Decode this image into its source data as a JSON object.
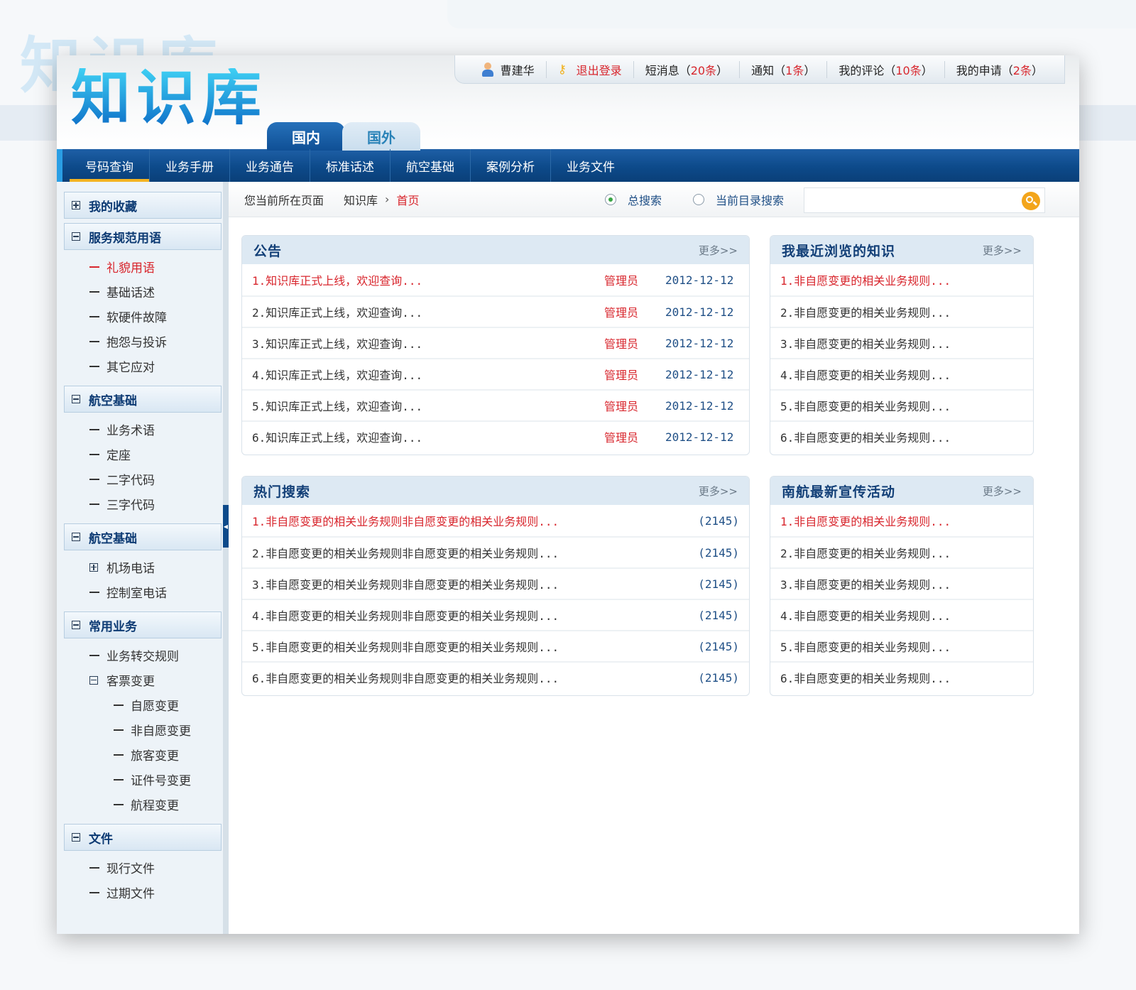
{
  "user_bar": {
    "username": "曹建华",
    "logout": "退出登录",
    "messages": {
      "label": "短消息",
      "count": "20条"
    },
    "notices": {
      "label": "通知",
      "count": "1条"
    },
    "comments": {
      "label": "我的评论",
      "count": "10条"
    },
    "requests": {
      "label": "我的申请",
      "count": "2条"
    }
  },
  "logo": "知识库",
  "region_tabs": [
    {
      "label": "国内",
      "active": true
    },
    {
      "label": "国外",
      "active": false
    }
  ],
  "nav": [
    {
      "label": "号码查询",
      "active": true
    },
    {
      "label": "业务手册"
    },
    {
      "label": "业务通告"
    },
    {
      "label": "标准话述"
    },
    {
      "label": "航空基础"
    },
    {
      "label": "案例分析"
    },
    {
      "label": "业务文件"
    }
  ],
  "breadcrumb": {
    "prefix": "您当前所在页面",
    "root": "知识库",
    "separator": "›",
    "current": "首页"
  },
  "search": {
    "options": [
      {
        "label": "总搜索",
        "checked": true
      },
      {
        "label": "当前目录搜索",
        "checked": false
      }
    ],
    "value": "",
    "placeholder": ""
  },
  "sidebar": {
    "groups": [
      {
        "title": "我的收藏",
        "expanded": false,
        "items": []
      },
      {
        "title": "服务规范用语",
        "expanded": true,
        "items": [
          {
            "label": "礼貌用语",
            "active": true
          },
          {
            "label": "基础话述"
          },
          {
            "label": "软硬件故障"
          },
          {
            "label": "抱怨与投诉"
          },
          {
            "label": "其它应对"
          }
        ]
      },
      {
        "title": "航空基础",
        "expanded": true,
        "items": [
          {
            "label": "业务术语"
          },
          {
            "label": "定座"
          },
          {
            "label": "二字代码"
          },
          {
            "label": "三字代码"
          }
        ]
      },
      {
        "title": "航空基础",
        "expanded": true,
        "items": [
          {
            "label": "机场电话",
            "expandable": true
          },
          {
            "label": "控制室电话"
          }
        ]
      },
      {
        "title": "常用业务",
        "expanded": true,
        "items": [
          {
            "label": "业务转交规则"
          },
          {
            "label": "客票变更",
            "collapsible": true
          },
          {
            "label": "自愿变更",
            "level": 2
          },
          {
            "label": "非自愿变更",
            "level": 2
          },
          {
            "label": "旅客变更",
            "level": 2
          },
          {
            "label": "证件号变更",
            "level": 2
          },
          {
            "label": "航程变更",
            "level": 2
          }
        ]
      },
      {
        "title": "文件",
        "expanded": true,
        "items": [
          {
            "label": "现行文件"
          },
          {
            "label": "过期文件"
          }
        ]
      }
    ]
  },
  "panels": {
    "announcements": {
      "title": "公告",
      "more": "更多>>",
      "rows": [
        {
          "text": "1.知识库正式上线，欢迎查询...",
          "author": "管理员",
          "date": "2012-12-12"
        },
        {
          "text": "2.知识库正式上线，欢迎查询...",
          "author": "管理员",
          "date": "2012-12-12"
        },
        {
          "text": "3.知识库正式上线，欢迎查询...",
          "author": "管理员",
          "date": "2012-12-12"
        },
        {
          "text": "4.知识库正式上线，欢迎查询...",
          "author": "管理员",
          "date": "2012-12-12"
        },
        {
          "text": "5.知识库正式上线，欢迎查询...",
          "author": "管理员",
          "date": "2012-12-12"
        },
        {
          "text": "6.知识库正式上线，欢迎查询...",
          "author": "管理员",
          "date": "2012-12-12"
        }
      ]
    },
    "recent": {
      "title": "我最近浏览的知识",
      "more": "更多>>",
      "rows": [
        {
          "text": "1.非自愿变更的相关业务规则..."
        },
        {
          "text": "2.非自愿变更的相关业务规则..."
        },
        {
          "text": "3.非自愿变更的相关业务规则..."
        },
        {
          "text": "4.非自愿变更的相关业务规则..."
        },
        {
          "text": "5.非自愿变更的相关业务规则..."
        },
        {
          "text": "6.非自愿变更的相关业务规则..."
        }
      ]
    },
    "hot_search": {
      "title": "热门搜索",
      "more": "更多>>",
      "rows": [
        {
          "text": "1.非自愿变更的相关业务规则非自愿变更的相关业务规则...",
          "count": "(2145)"
        },
        {
          "text": "2.非自愿变更的相关业务规则非自愿变更的相关业务规则...",
          "count": "(2145)"
        },
        {
          "text": "3.非自愿变更的相关业务规则非自愿变更的相关业务规则...",
          "count": "(2145)"
        },
        {
          "text": "4.非自愿变更的相关业务规则非自愿变更的相关业务规则...",
          "count": "(2145)"
        },
        {
          "text": "5.非自愿变更的相关业务规则非自愿变更的相关业务规则...",
          "count": "(2145)"
        },
        {
          "text": "6.非自愿变更的相关业务规则非自愿变更的相关业务规则...",
          "count": "(2145)"
        }
      ]
    },
    "promotions": {
      "title": "南航最新宣传活动",
      "more": "更多>>",
      "rows": [
        {
          "text": "1.非自愿变更的相关业务规则..."
        },
        {
          "text": "2.非自愿变更的相关业务规则..."
        },
        {
          "text": "3.非自愿变更的相关业务规则..."
        },
        {
          "text": "4.非自愿变更的相关业务规则..."
        },
        {
          "text": "5.非自愿变更的相关业务规则..."
        },
        {
          "text": "6.非自愿变更的相关业务规则..."
        }
      ]
    }
  },
  "colors": {
    "brand_blue": "#0d4a8a",
    "highlight_red": "#d8262d",
    "accent_orange": "#f3a51b"
  }
}
